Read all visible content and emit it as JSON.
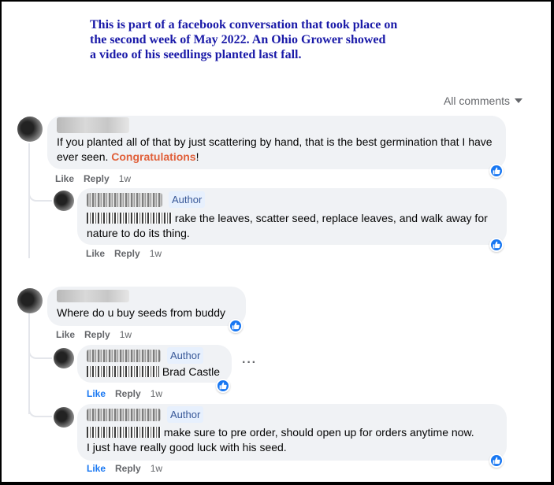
{
  "note": {
    "line1": "This is part of a facebook conversation that took place on",
    "line2": "the second week of May 2022.  An Ohio Grower showed",
    "line3": "a video of his seedlings planted last fall."
  },
  "sort": {
    "label": "All comments"
  },
  "author_label": "Author",
  "actions": {
    "like": "Like",
    "reply": "Reply"
  },
  "comments": [
    {
      "text_a": "If you planted all of that by just scattering by hand, that is the best germination that I have ever seen. ",
      "highlight": "Congratulations",
      "text_b": "!",
      "time": "1w",
      "liked": false
    },
    {
      "text": "rake the leaves, scatter seed, replace leaves, and walk away for nature to do its thing.",
      "time": "1w",
      "liked": false
    },
    {
      "text": "Where do u buy seeds from buddy",
      "time": "1w",
      "liked": false
    },
    {
      "text": "Brad Castle",
      "time": "1w",
      "liked": true
    },
    {
      "text_a": "make sure to pre order, should open up for orders anytime now.",
      "text_b": "I just have really good luck with his seed.",
      "time": "1w",
      "liked": true
    }
  ],
  "colors": {
    "like_blue": "#1877f2",
    "note_blue": "#1a1aa8",
    "accent": "#e0603a",
    "bubble": "#f0f2f5"
  },
  "icons": [
    "like-reaction-icon",
    "chevron-down-icon",
    "more-options-icon"
  ]
}
